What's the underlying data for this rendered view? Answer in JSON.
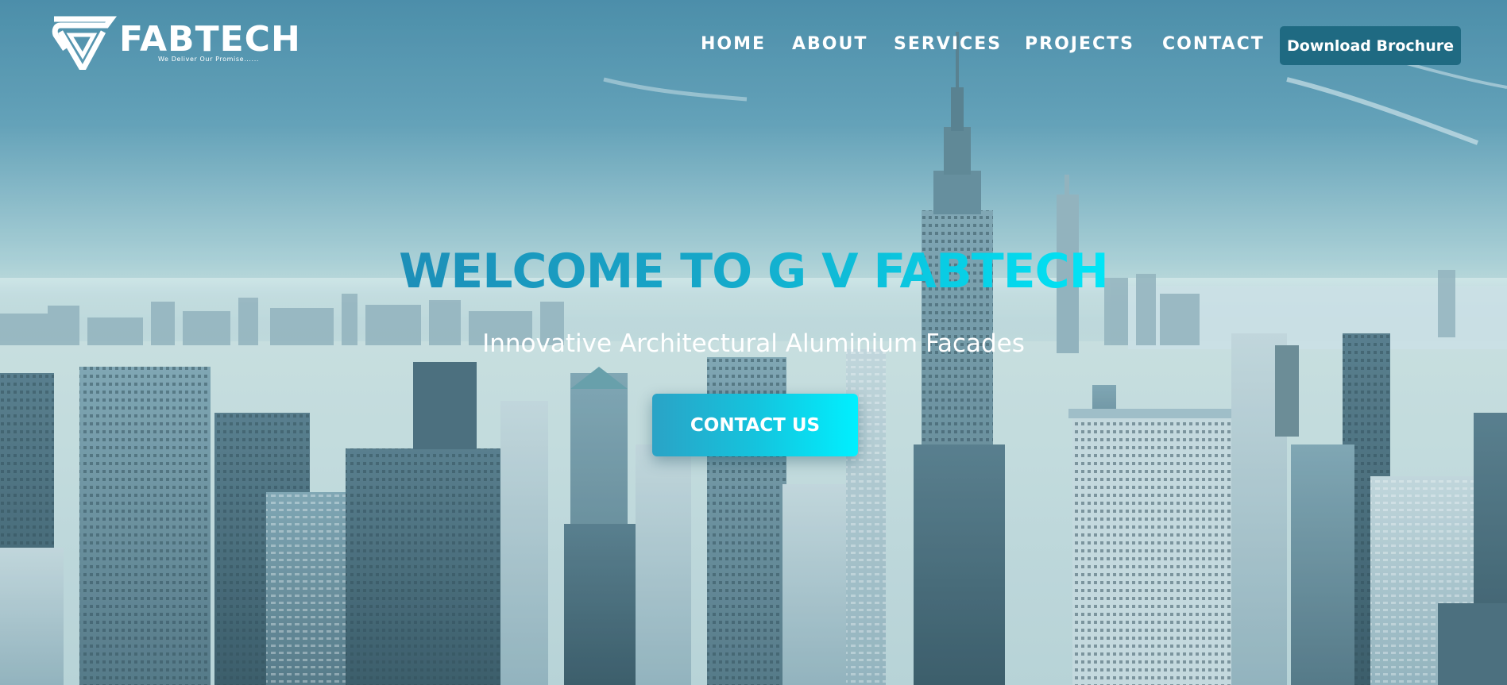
{
  "brand": {
    "name": "FABTECH",
    "tagline": "We Deliver Our Promise......",
    "logo_icon": "gv-chevron-logo-icon"
  },
  "nav": {
    "items": [
      {
        "label": "HOME"
      },
      {
        "label": "ABOUT"
      },
      {
        "label": "SERVICES"
      },
      {
        "label": "PROJECTS"
      },
      {
        "label": "CONTACT"
      }
    ],
    "brochure_label": "Download Brochure"
  },
  "hero": {
    "title": "WELCOME TO G V FABTECH",
    "subtitle": "Innovative Architectural Aluminium Facades",
    "cta_label": "CONTACT US",
    "background": "city-skyline-photo"
  },
  "colors": {
    "accent_cyan": "#00e6f7",
    "accent_blue": "#1d8fb8",
    "brochure_bg": "#1f6a82",
    "text_white": "#ffffff"
  }
}
